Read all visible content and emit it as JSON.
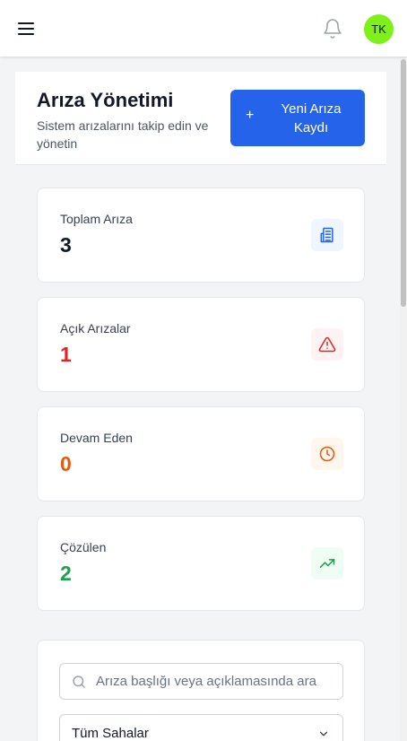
{
  "header": {
    "avatar_initials": "TK",
    "avatar_color": "#7ef01a"
  },
  "page": {
    "title": "Arıza Yönetimi",
    "subtitle": "Sistem arızalarını takip edin ve yönetin",
    "new_button_plus": "+",
    "new_button_label": "Yeni Arıza Kaydı",
    "accent_color": "#2563eb"
  },
  "stats": [
    {
      "label": "Toplam Arıza",
      "value": "3",
      "icon": "building-icon",
      "color": "#111827",
      "icon_color": "#2563eb",
      "icon_bg": "#eff6ff"
    },
    {
      "label": "Açık Arızalar",
      "value": "1",
      "icon": "warning-icon",
      "color": "#dc2626",
      "icon_color": "#dc2626",
      "icon_bg": "#fef2f2"
    },
    {
      "label": "Devam Eden",
      "value": "0",
      "icon": "clock-icon",
      "color": "#ea580c",
      "icon_color": "#ea580c",
      "icon_bg": "#fff7ed"
    },
    {
      "label": "Çözülen",
      "value": "2",
      "icon": "trending-up-icon",
      "color": "#16a34a",
      "icon_color": "#16a34a",
      "icon_bg": "#f0fdf4"
    }
  ],
  "filters": {
    "search_placeholder": "Arıza başlığı veya açıklamasında ara",
    "search_value": "",
    "site_select_value": "Tüm Sahalar"
  }
}
